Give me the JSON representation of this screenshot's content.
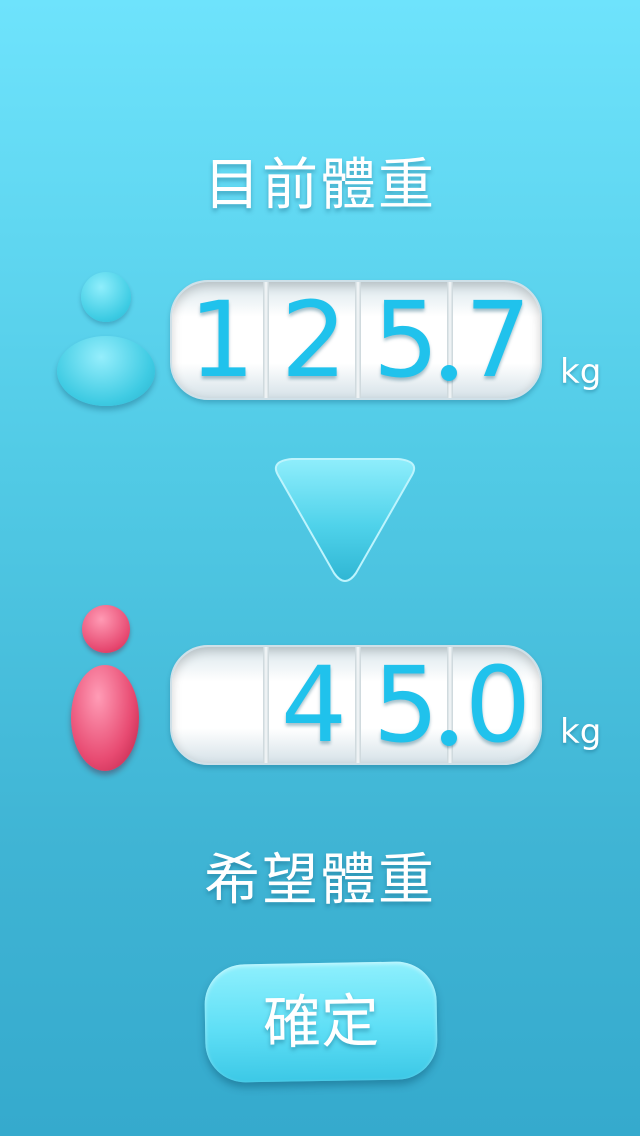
{
  "current": {
    "title": "目前體重",
    "digits": [
      "1",
      "2",
      "5",
      "7"
    ],
    "unit": "kg"
  },
  "target": {
    "title": "希望體重",
    "digits": [
      "",
      "4",
      "5",
      "0"
    ],
    "unit": "kg"
  },
  "confirm_label": "確定",
  "colors": {
    "digit": "#20c2ec",
    "current_person": "#3ccbe3",
    "target_person": "#e6476f"
  },
  "icons": {
    "current_person": "person-icon",
    "target_person": "person-icon",
    "arrow": "triangle-down-icon"
  }
}
